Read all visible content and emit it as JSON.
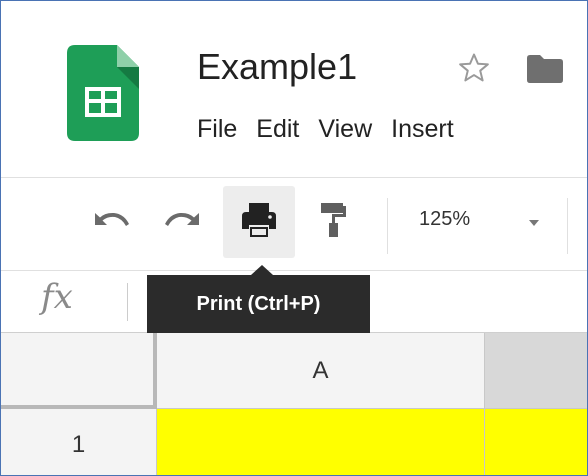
{
  "document": {
    "title": "Example1",
    "logo_icon": "sheets-logo-icon",
    "star_icon": "star-icon",
    "folder_icon": "folder-icon"
  },
  "menu": {
    "items": [
      "File",
      "Edit",
      "View",
      "Insert"
    ]
  },
  "toolbar": {
    "undo_icon": "undo-icon",
    "redo_icon": "redo-icon",
    "print_icon": "print-icon",
    "paint_format_icon": "paint-format-icon",
    "zoom": "125%",
    "zoom_dropdown_icon": "dropdown-arrow-icon"
  },
  "tooltip": {
    "text": "Print (Ctrl+P)"
  },
  "formula_bar": {
    "label": "fx",
    "value": ""
  },
  "grid": {
    "column_headers": [
      "A"
    ],
    "row_headers": [
      "1"
    ]
  },
  "colors": {
    "logo": "#1e9e57",
    "highlight_cell": "#ffff00",
    "tooltip_bg": "#2b2b2b",
    "frame_border": "#4a73b4"
  }
}
